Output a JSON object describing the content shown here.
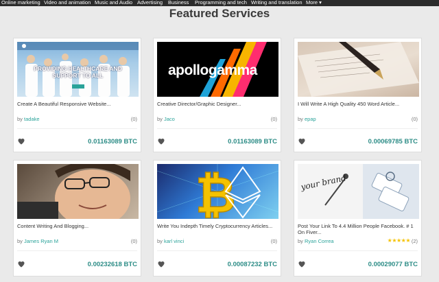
{
  "nav": {
    "items": [
      "Online marketing",
      "Video and animation",
      "Music and Audio",
      "Advertising",
      "Business",
      "Programming and tech",
      "Writing and translation"
    ],
    "more": "More ▾"
  },
  "section_title": "Featured Services",
  "cards": [
    {
      "title": "Create A Beautiful Responsive Website...",
      "by": "by",
      "seller": "tadake",
      "count": "(0)",
      "price": "0.01163089 BTC",
      "thumb_text": "PROVIDING HEALTHCARE AND SUPPORT TO ALL"
    },
    {
      "title": "Creative Director/Graphic Designer...",
      "by": "by",
      "seller": "Jaco",
      "count": "(0)",
      "price": "0.01163089 BTC",
      "thumb_text": "apollogamma"
    },
    {
      "title": "I Will Write A High Quality 450 Word Article...",
      "by": "by",
      "seller": "epap",
      "count": "(0)",
      "price": "0.00069785 BTC"
    },
    {
      "title": "Content Writing And Blogging...",
      "by": "by",
      "seller": "James Ryan M",
      "count": "(0)",
      "price": "0.00232618 BTC"
    },
    {
      "title": "Write You Indepth Timely Cryptocurrency Articles...",
      "by": "by",
      "seller": "karl vinci",
      "count": "(0)",
      "price": "0.00087232 BTC"
    },
    {
      "title": "Post Your Link To 4.4 Million People Facebook. # 1 On Fiver...",
      "by": "by",
      "seller": "Ryan Correa",
      "count": "(2)",
      "stars": "★★★★★",
      "price": "0.00029077 BTC",
      "thumb_text": "your brand"
    }
  ],
  "colors": {
    "accent": "#2aa39a",
    "price": "#2c8c86",
    "nav_bg": "#2b2b2b",
    "star": "#f5c200"
  }
}
